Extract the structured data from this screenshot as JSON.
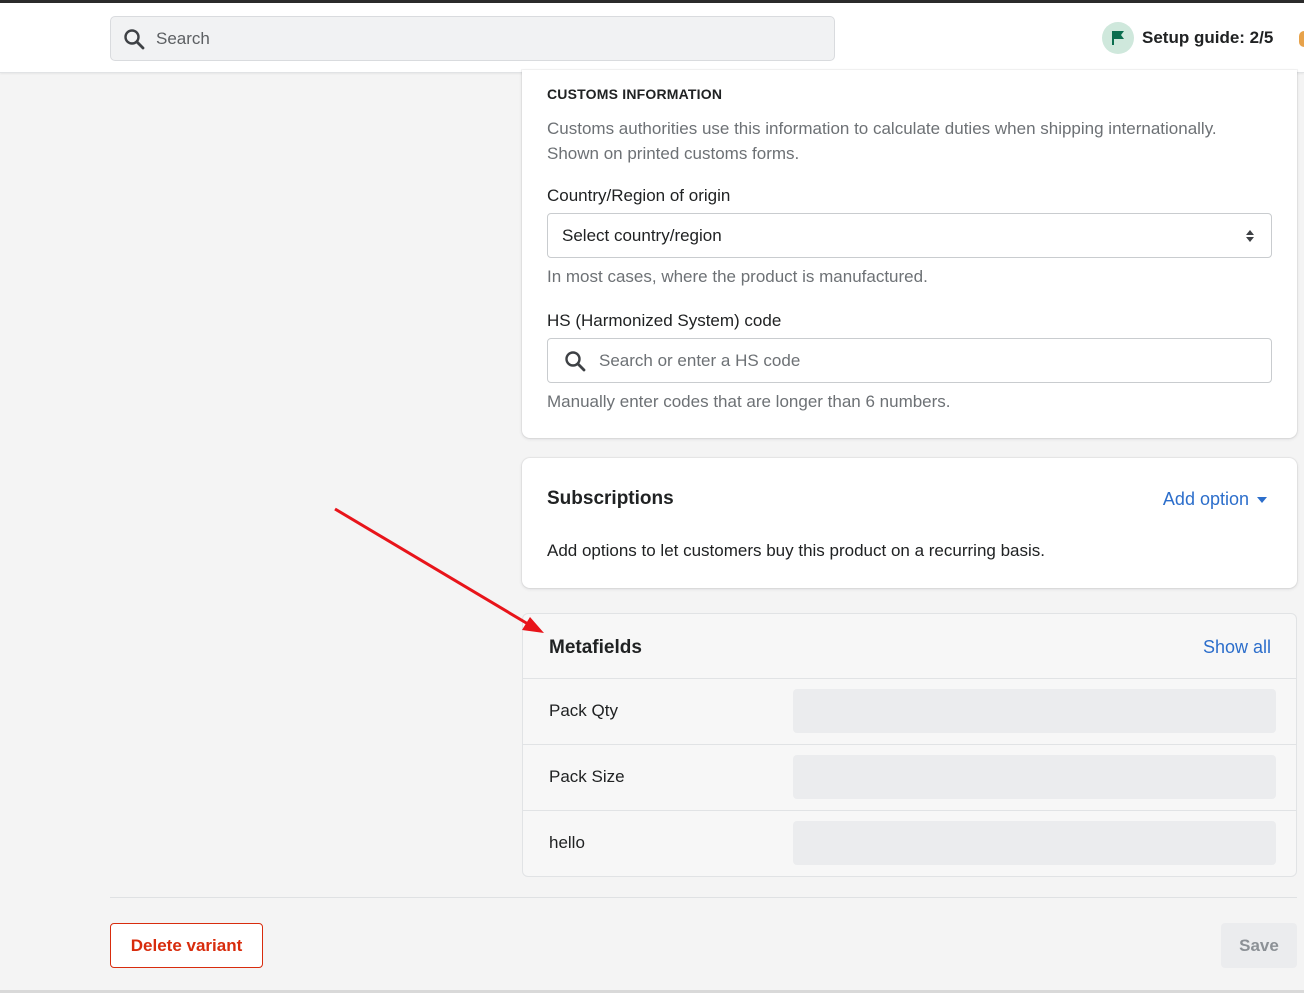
{
  "header": {
    "search_placeholder": "Search",
    "setup_guide": "Setup guide: 2/5"
  },
  "customs": {
    "title": "CUSTOMS INFORMATION",
    "description": "Customs authorities use this information to calculate duties when shipping internationally. Shown on printed customs forms.",
    "country_label": "Country/Region of origin",
    "country_value": "Select country/region",
    "country_hint": "In most cases, where the product is manufactured.",
    "hs_label": "HS (Harmonized System) code",
    "hs_placeholder": "Search or enter a HS code",
    "hs_hint": "Manually enter codes that are longer than 6 numbers."
  },
  "subscriptions": {
    "title": "Subscriptions",
    "add_option": "Add option",
    "text": "Add options to let customers buy this product on a recurring basis."
  },
  "metafields": {
    "title": "Metafields",
    "show_all": "Show all",
    "rows": [
      {
        "name": "Pack Qty",
        "value": ""
      },
      {
        "name": "Pack Size",
        "value": ""
      },
      {
        "name": "hello",
        "value": ""
      }
    ]
  },
  "footer": {
    "delete_label": "Delete variant",
    "save_label": "Save"
  },
  "colors": {
    "accent": "#2c6ecb",
    "critical": "#d82c0d",
    "annotation_arrow": "#e8141a"
  }
}
